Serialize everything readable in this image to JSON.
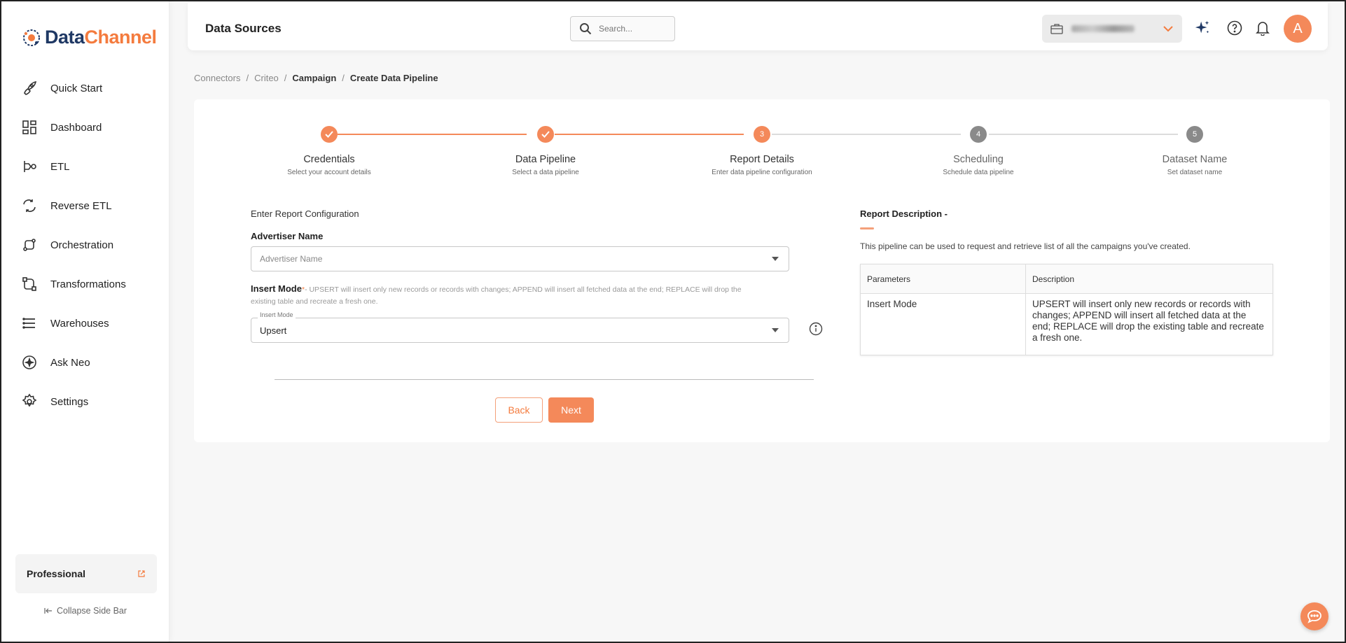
{
  "brand": {
    "part1": "Data",
    "part2": "Channel"
  },
  "sidebar": {
    "items": [
      {
        "label": "Quick Start",
        "icon": "rocket-icon"
      },
      {
        "label": "Dashboard",
        "icon": "dashboard-icon"
      },
      {
        "label": "ETL",
        "icon": "etl-icon"
      },
      {
        "label": "Reverse ETL",
        "icon": "reverse-etl-icon"
      },
      {
        "label": "Orchestration",
        "icon": "orchestration-icon"
      },
      {
        "label": "Transformations",
        "icon": "transformations-icon"
      },
      {
        "label": "Warehouses",
        "icon": "warehouses-icon"
      },
      {
        "label": "Ask Neo",
        "icon": "sparkle-icon"
      },
      {
        "label": "Settings",
        "icon": "gear-icon"
      }
    ],
    "plan": "Professional",
    "collapse": "Collapse Side Bar"
  },
  "header": {
    "title": "Data Sources",
    "search_placeholder": "Search...",
    "avatar": "A"
  },
  "breadcrumb": [
    "Connectors",
    "Criteo",
    "Campaign",
    "Create Data Pipeline"
  ],
  "stepper": {
    "current": 3,
    "steps": [
      {
        "num": "1",
        "title": "Credentials",
        "sub": "Select your account details",
        "state": "done"
      },
      {
        "num": "2",
        "title": "Data Pipeline",
        "sub": "Select a data pipeline",
        "state": "done"
      },
      {
        "num": "3",
        "title": "Report Details",
        "sub": "Enter data pipeline configuration",
        "state": "active"
      },
      {
        "num": "4",
        "title": "Scheduling",
        "sub": "Schedule data pipeline",
        "state": "pending"
      },
      {
        "num": "5",
        "title": "Dataset Name",
        "sub": "Set dataset name",
        "state": "pending"
      }
    ]
  },
  "form": {
    "heading": "Enter Report Configuration",
    "advertiser_label": "Advertiser Name",
    "advertiser_placeholder": "Advertiser Name",
    "insert_mode_label": "Insert Mode",
    "insert_mode_required": "*",
    "insert_mode_help": "- UPSERT will insert only new records or records with changes; APPEND will insert all fetched data at the end; REPLACE will drop the existing table and recreate a fresh one.",
    "insert_mode_float": "Insert Mode",
    "insert_mode_value": "Upsert",
    "back": "Back",
    "next": "Next"
  },
  "description": {
    "title": "Report Description -",
    "text": "This pipeline can be used to request and retrieve list of all the campaigns you've created.",
    "table_headers": [
      "Parameters",
      "Description"
    ],
    "rows": [
      {
        "param": "Insert Mode",
        "desc": "UPSERT will insert only new records or records with changes; APPEND will insert all fetched data at the end; REPLACE will drop the existing table and recreate a fresh one."
      }
    ]
  },
  "colors": {
    "accent": "#f47b3e",
    "brand_dark": "#1f3864",
    "pending": "#8a8a8a"
  }
}
